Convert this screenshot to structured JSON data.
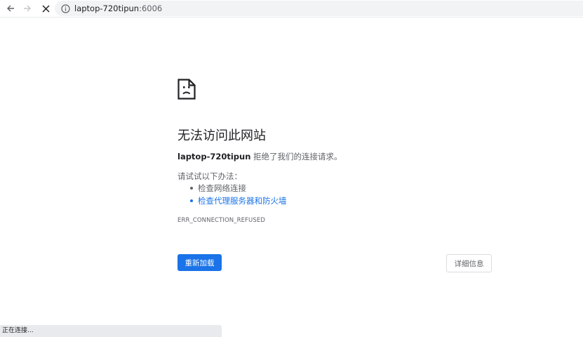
{
  "browser": {
    "back_icon": "arrow-left-icon",
    "forward_icon": "arrow-right-icon",
    "stop_icon": "close-icon",
    "info_icon": "info-circle-icon",
    "url_host": "laptop-720tipun",
    "url_port": ":6006"
  },
  "error_page": {
    "icon": "sad-document-icon",
    "title": "无法访问此网站",
    "summary_host": "laptop-720tipun",
    "summary_text": " 拒绝了我们的连接请求。",
    "try_label": "请试试以下办法：",
    "suggestions": [
      {
        "label": "检查网络连接",
        "is_link": false
      },
      {
        "label": "检查代理服务器和防火墙",
        "is_link": true
      }
    ],
    "error_code": "ERR_CONNECTION_REFUSED",
    "reload_label": "重新加载",
    "details_label": "详细信息"
  },
  "status_bar": {
    "text": "正在连接..."
  },
  "colors": {
    "accent": "#1a73e8",
    "text_primary": "#202124",
    "text_secondary": "#5f6368",
    "omnibox_bg": "#f1f3f4",
    "status_bg": "#e8eaed"
  }
}
